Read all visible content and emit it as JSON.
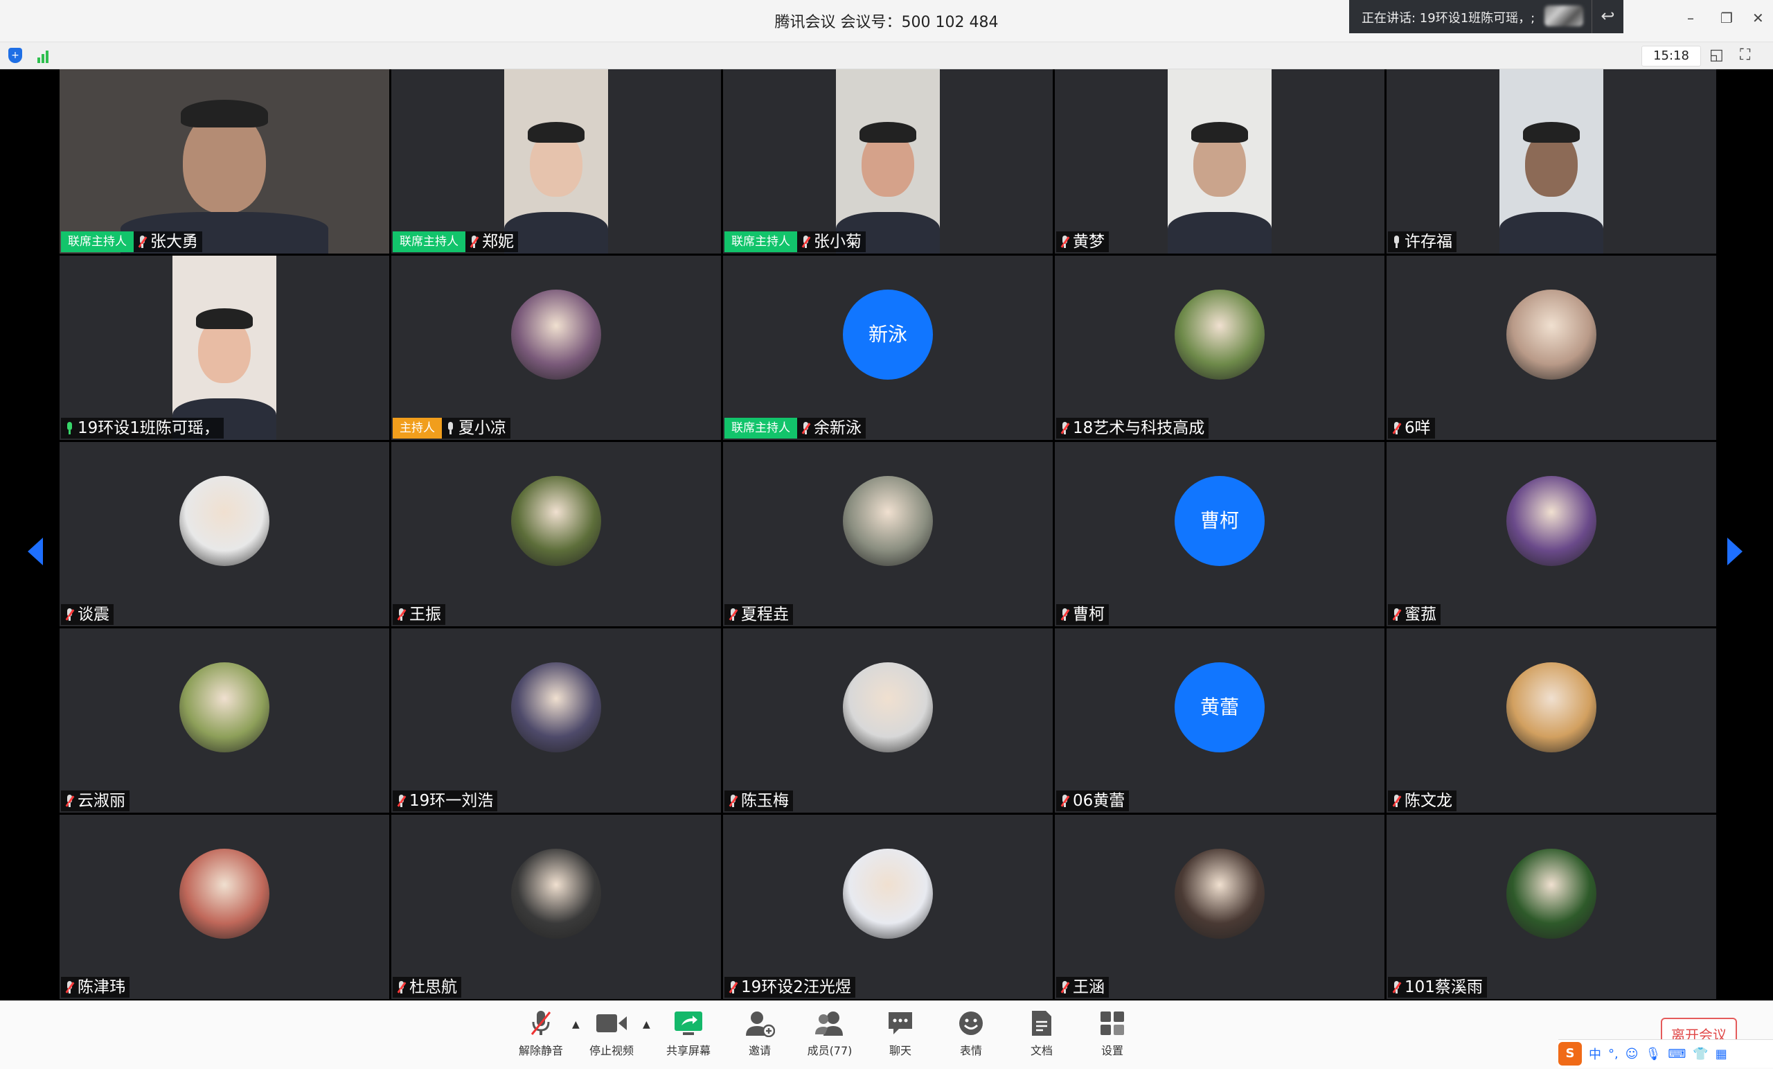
{
  "titlebar": {
    "title": "腾讯会议 会议号：500 102 484",
    "speaking": "正在讲话: 19环设1班陈可瑶，;",
    "minimize": "–",
    "restore": "❐",
    "close": "✕"
  },
  "infobar": {
    "time": "15:18"
  },
  "participants": [
    {
      "name": "张大勇",
      "badge": "联席主持人",
      "badge_type": "co",
      "mic": "muted",
      "mode": "video",
      "skin": "#b48c74",
      "bg": "#4a4644"
    },
    {
      "name": "郑妮",
      "badge": "联席主持人",
      "badge_type": "co",
      "mic": "muted",
      "mode": "video-narrow",
      "skin": "#e6c3ad",
      "bg": "#d9d2c9"
    },
    {
      "name": "张小菊",
      "badge": "联席主持人",
      "badge_type": "co",
      "mic": "muted",
      "mode": "video-narrow",
      "skin": "#d5a28a",
      "bg": "#d6d4cf"
    },
    {
      "name": "黄梦",
      "badge": "",
      "badge_type": "",
      "mic": "muted",
      "mode": "video-narrow",
      "skin": "#caa48c",
      "bg": "#e8e8e6"
    },
    {
      "name": "许存福",
      "badge": "",
      "badge_type": "",
      "mic": "on",
      "mode": "video-narrow",
      "skin": "#8c6a56",
      "bg": "#d8dce0"
    },
    {
      "name": "19环设1班陈可瑶，",
      "badge": "",
      "badge_type": "",
      "mic": "active",
      "mode": "video-narrow",
      "skin": "#e8bca4",
      "bg": "#e9e2dc"
    },
    {
      "name": "夏小凉",
      "badge": "主持人",
      "badge_type": "host",
      "mic": "on",
      "mode": "avatar",
      "avatar_color": "#7a5a7a"
    },
    {
      "name": "余新泳",
      "badge": "联席主持人",
      "badge_type": "co",
      "mic": "muted",
      "mode": "text",
      "avatar_text": "新泳"
    },
    {
      "name": "18艺术与科技高成",
      "badge": "",
      "badge_type": "",
      "mic": "muted",
      "mode": "avatar",
      "avatar_color": "#6e8a4a"
    },
    {
      "name": "6咩",
      "badge": "",
      "badge_type": "",
      "mic": "muted",
      "mode": "avatar",
      "avatar_color": "#b99a88"
    },
    {
      "name": "谈震",
      "badge": "",
      "badge_type": "",
      "mic": "muted",
      "mode": "avatar",
      "avatar_color": "#e8e8e8"
    },
    {
      "name": "王振",
      "badge": "",
      "badge_type": "",
      "mic": "muted",
      "mode": "avatar",
      "avatar_color": "#5d6e3a"
    },
    {
      "name": "夏程垚",
      "badge": "",
      "badge_type": "",
      "mic": "muted",
      "mode": "avatar",
      "avatar_color": "#8a8e80"
    },
    {
      "name": "曹柯",
      "badge": "",
      "badge_type": "",
      "mic": "muted",
      "mode": "text",
      "avatar_text": "曹柯"
    },
    {
      "name": "蜜菰",
      "badge": "",
      "badge_type": "",
      "mic": "muted",
      "mode": "avatar",
      "avatar_color": "#6a4a8a"
    },
    {
      "name": "云淑丽",
      "badge": "",
      "badge_type": "",
      "mic": "muted",
      "mode": "avatar",
      "avatar_color": "#8ea05a"
    },
    {
      "name": "19环一刘浩",
      "badge": "",
      "badge_type": "",
      "mic": "muted",
      "mode": "avatar",
      "avatar_color": "#4e4a6a"
    },
    {
      "name": "陈玉梅",
      "badge": "",
      "badge_type": "",
      "mic": "muted",
      "mode": "avatar",
      "avatar_color": "#d8d8d8"
    },
    {
      "name": "06黄蕾",
      "badge": "",
      "badge_type": "",
      "mic": "muted",
      "mode": "text",
      "avatar_text": "黄蕾"
    },
    {
      "name": "陈文龙",
      "badge": "",
      "badge_type": "",
      "mic": "muted",
      "mode": "avatar",
      "avatar_color": "#d2a060"
    },
    {
      "name": "陈津玮",
      "badge": "",
      "badge_type": "",
      "mic": "muted",
      "mode": "avatar",
      "avatar_color": "#c0685a"
    },
    {
      "name": "杜思航",
      "badge": "",
      "badge_type": "",
      "mic": "muted",
      "mode": "avatar",
      "avatar_color": "#3a3a3a"
    },
    {
      "name": "19环设2汪光煜",
      "badge": "",
      "badge_type": "",
      "mic": "muted",
      "mode": "avatar",
      "avatar_color": "#e8eaf0"
    },
    {
      "name": "王涵",
      "badge": "",
      "badge_type": "",
      "mic": "muted",
      "mode": "avatar",
      "avatar_color": "#4a3a34"
    },
    {
      "name": "101蔡溪雨",
      "badge": "",
      "badge_type": "",
      "mic": "muted",
      "mode": "avatar",
      "avatar_color": "#2e5a2a"
    }
  ],
  "toolbar": {
    "unmute": "解除静音",
    "stop_video": "停止视频",
    "share_screen": "共享屏幕",
    "invite": "邀请",
    "members": "成员(77)",
    "chat": "聊天",
    "emoji": "表情",
    "docs": "文档",
    "settings": "设置",
    "leave": "离开会议"
  },
  "ime": {
    "logo": "S",
    "lang": "中",
    "punct": "°,"
  },
  "colors": {
    "accent": "#1e6fff",
    "cohost_badge": "#12c46b",
    "host_badge": "#f19e1c",
    "tile_bg": "#2b2c30"
  }
}
